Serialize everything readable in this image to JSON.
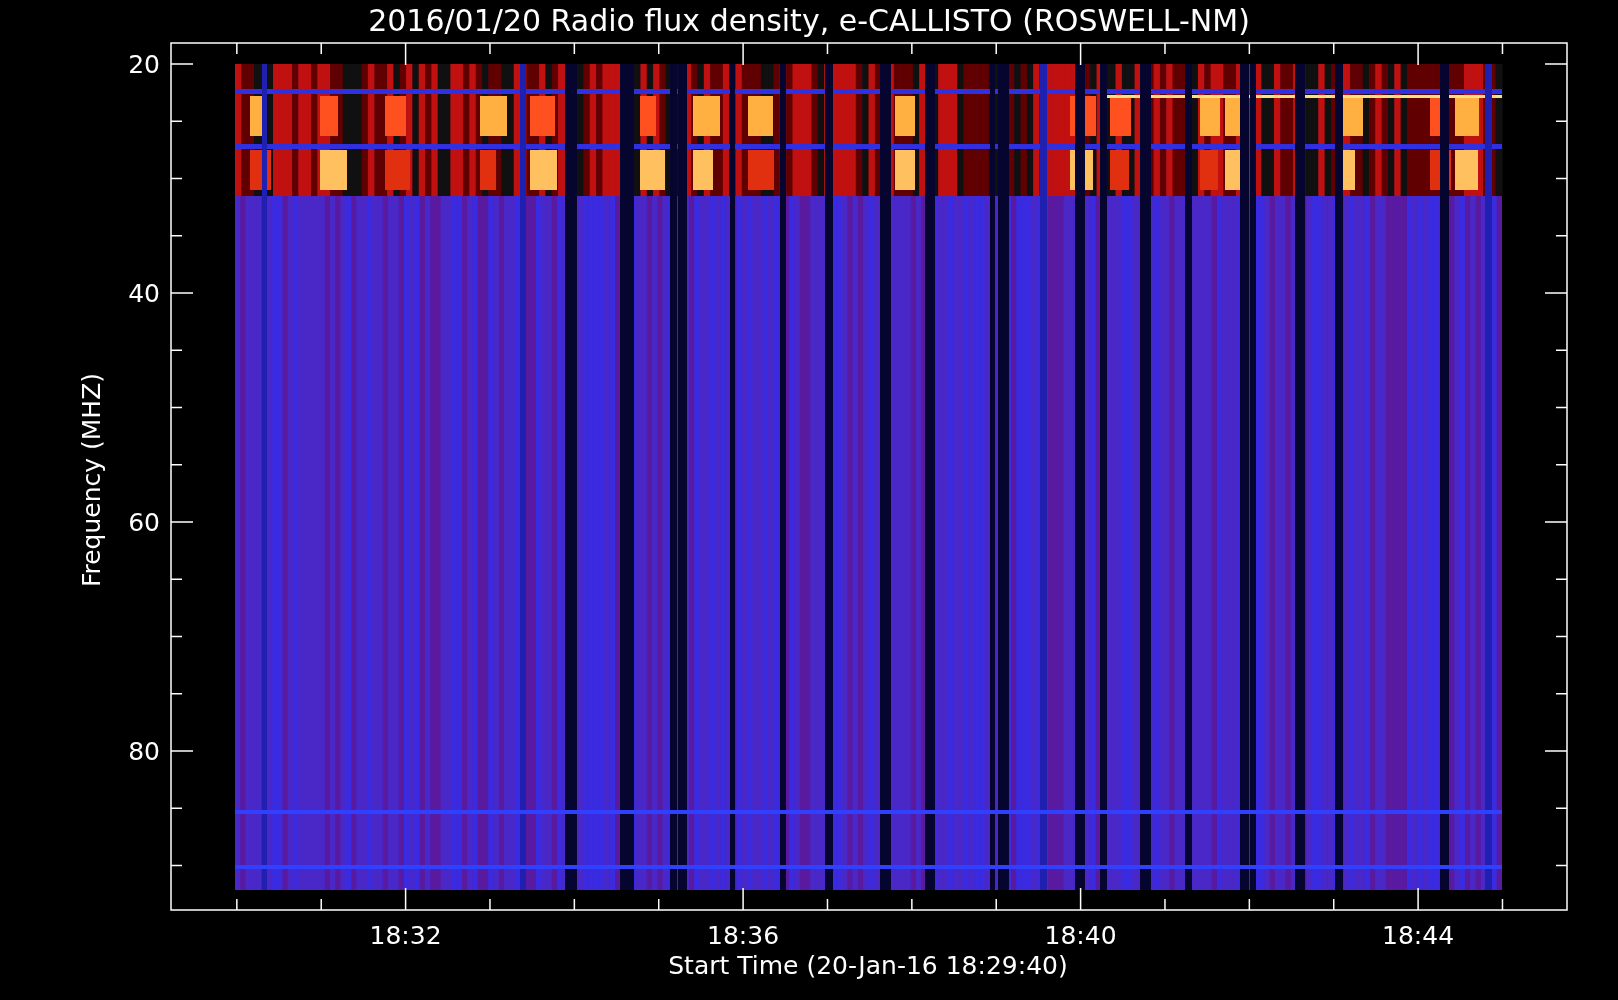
{
  "title": "2016/01/20  Radio flux density, e-CALLISTO (ROSWELL-NM)",
  "y_axis": {
    "label": "Frequency (MHZ)",
    "ticks": [
      "20",
      "40",
      "60",
      "80"
    ]
  },
  "x_axis": {
    "label": "Start Time (20-Jan-16 18:29:40)",
    "ticks": [
      "18:32",
      "18:36",
      "18:40",
      "18:44"
    ]
  }
}
